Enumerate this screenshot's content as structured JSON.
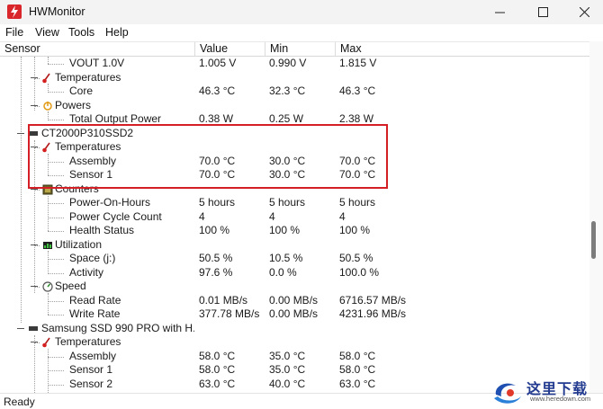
{
  "window": {
    "title": "HWMonitor"
  },
  "menu": [
    "File",
    "View",
    "Tools",
    "Help"
  ],
  "columns": [
    "Sensor",
    "Value",
    "Min",
    "Max"
  ],
  "rows": [
    {
      "name": "VOUT 1.0V",
      "value": "1.005 V",
      "min": "0.990 V",
      "max": "1.815 V"
    },
    {
      "name": "Temperatures",
      "value": "",
      "min": "",
      "max": ""
    },
    {
      "name": "Core",
      "value": "46.3 °C",
      "min": "32.3 °C",
      "max": "46.3 °C"
    },
    {
      "name": "Powers",
      "value": "",
      "min": "",
      "max": ""
    },
    {
      "name": "Total Output Power",
      "value": "0.38 W",
      "min": "0.25 W",
      "max": "2.38 W"
    },
    {
      "name": "CT2000P310SSD2",
      "value": "",
      "min": "",
      "max": ""
    },
    {
      "name": "Temperatures",
      "value": "",
      "min": "",
      "max": ""
    },
    {
      "name": "Assembly",
      "value": "70.0 °C",
      "min": "30.0 °C",
      "max": "70.0 °C"
    },
    {
      "name": "Sensor 1",
      "value": "70.0 °C",
      "min": "30.0 °C",
      "max": "70.0 °C"
    },
    {
      "name": "Counters",
      "value": "",
      "min": "",
      "max": ""
    },
    {
      "name": "Power-On-Hours",
      "value": "5 hours",
      "min": "5 hours",
      "max": "5 hours"
    },
    {
      "name": "Power Cycle Count",
      "value": "4",
      "min": "4",
      "max": "4"
    },
    {
      "name": "Health Status",
      "value": "100 %",
      "min": "100 %",
      "max": "100 %"
    },
    {
      "name": "Utilization",
      "value": "",
      "min": "",
      "max": ""
    },
    {
      "name": "Space (j:)",
      "value": "50.5 %",
      "min": "10.5 %",
      "max": "50.5 %"
    },
    {
      "name": "Activity",
      "value": "97.6 %",
      "min": "0.0 %",
      "max": "100.0 %"
    },
    {
      "name": "Speed",
      "value": "",
      "min": "",
      "max": ""
    },
    {
      "name": "Read Rate",
      "value": "0.01 MB/s",
      "min": "0.00 MB/s",
      "max": "6716.57 MB/s"
    },
    {
      "name": "Write Rate",
      "value": "377.78 MB/s",
      "min": "0.00 MB/s",
      "max": "4231.96 MB/s"
    },
    {
      "name": "Samsung SSD 990 PRO with H...",
      "value": "",
      "min": "",
      "max": ""
    },
    {
      "name": "Temperatures",
      "value": "",
      "min": "",
      "max": ""
    },
    {
      "name": "Assembly",
      "value": "58.0 °C",
      "min": "35.0 °C",
      "max": "58.0 °C"
    },
    {
      "name": "Sensor 1",
      "value": "58.0 °C",
      "min": "35.0 °C",
      "max": "58.0 °C"
    },
    {
      "name": "Sensor 2",
      "value": "63.0 °C",
      "min": "40.0 °C",
      "max": "63.0 °C"
    }
  ],
  "status": "Ready",
  "watermark": {
    "text": "这里下载",
    "url": "www.heredown.com"
  },
  "colors": {
    "highlight": "#d51f26",
    "app_icon": "#d9262b"
  }
}
